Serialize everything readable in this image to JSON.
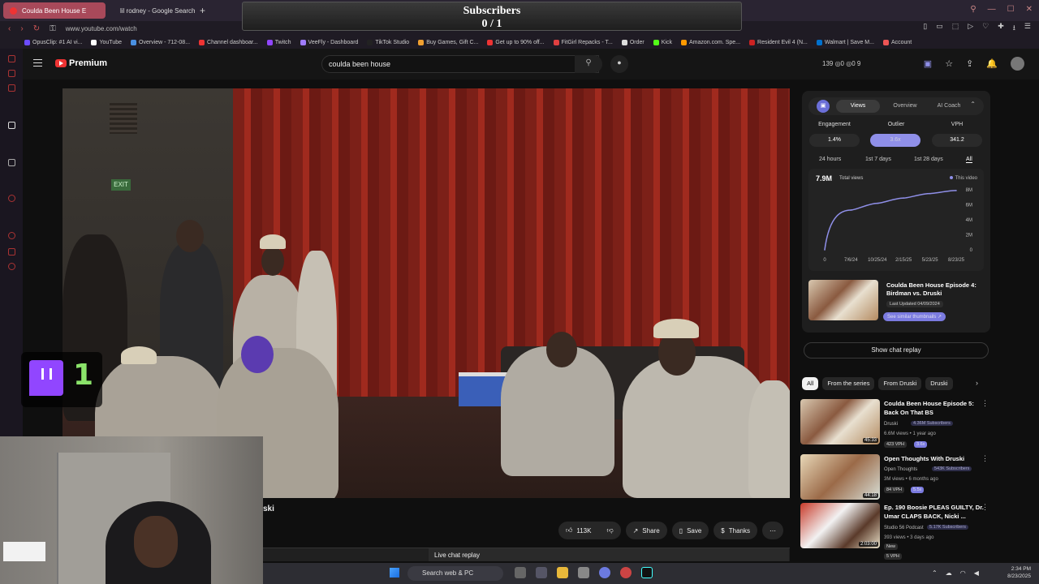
{
  "browser": {
    "tabs": [
      {
        "label": "Coulda Been House E",
        "active": true
      },
      {
        "label": "lil rodney - Google Search",
        "active": false
      }
    ],
    "new_tab": "+",
    "url": "www.youtube.com/watch",
    "bookmarks": [
      {
        "label": "OpusClip: #1 AI vi...",
        "color": "#6c4cff"
      },
      {
        "label": "YouTube",
        "color": "#ffffff"
      },
      {
        "label": "Overview - 712-08...",
        "color": "#4a90e2"
      },
      {
        "label": "Channel dashboar...",
        "color": "#e33"
      },
      {
        "label": "Twitch",
        "color": "#9146ff"
      },
      {
        "label": "VeeFly - Dashboard",
        "color": "#a07cff"
      },
      {
        "label": "TikTok Studio",
        "color": "#222222"
      },
      {
        "label": "Buy Games, Gift C...",
        "color": "#f0a030"
      },
      {
        "label": "Get up to 90% off...",
        "color": "#e33"
      },
      {
        "label": "FitGirl Repacks - T...",
        "color": "#e04040"
      },
      {
        "label": "Order",
        "color": "#dddddd"
      },
      {
        "label": "Kick",
        "color": "#53fc18"
      },
      {
        "label": "Amazon.com. Spe...",
        "color": "#ff9900"
      },
      {
        "label": "Resident Evil 4 (N...",
        "color": "#cc2222"
      },
      {
        "label": "Walmart | Save M...",
        "color": "#0071ce"
      },
      {
        "label": "Account",
        "color": "#e55"
      }
    ]
  },
  "overlay": {
    "title": "Subscribers",
    "count": "0 / 1"
  },
  "youtube": {
    "logo_label": "Premium",
    "search_value": "coulda been house",
    "header_stats": "139 ◎0 ◎0 9"
  },
  "video": {
    "exit_sign": "EXIT",
    "title_fragment": "ski",
    "like_count": "113K",
    "share_label": "Share",
    "save_label": "Save",
    "thanks_label": "Thanks",
    "live_chat_label": "Live chat replay"
  },
  "twitch": {
    "viewer_count": "1"
  },
  "panel": {
    "tabs": [
      "Views",
      "Overview",
      "AI Coach"
    ],
    "active_tab": "Views",
    "metrics": [
      {
        "label": "Engagement",
        "value": "1.4%"
      },
      {
        "label": "Outlier",
        "value": "3.6x"
      },
      {
        "label": "VPH",
        "value": "341.2"
      }
    ],
    "ranges": [
      "24 hours",
      "1st 7 days",
      "1st 28 days",
      "All"
    ],
    "active_range": "All",
    "total_views_value": "7.9M",
    "total_views_label": "Total views",
    "legend": "This video",
    "featured": {
      "title": "Coulda Been House Episode 4: Birdman vs. Druski",
      "updated": "Last Updated 04/09/2024",
      "similar_button": "See similar thumbnails ↗"
    }
  },
  "chart_data": {
    "type": "line",
    "title": "",
    "x": [
      "0",
      "7/6/24",
      "10/25/24",
      "2/15/25",
      "5/23/25",
      "8/23/25"
    ],
    "series": [
      {
        "name": "This video",
        "values": [
          0,
          5.3,
          6.2,
          6.9,
          7.5,
          7.9
        ]
      }
    ],
    "yticks": [
      "8M",
      "6M",
      "4M",
      "2M",
      "0"
    ],
    "ylim": [
      0,
      8
    ],
    "legend": "top-right",
    "grid": false
  },
  "sidebar": {
    "show_chat": "Show chat replay",
    "chips": [
      "All",
      "From the series",
      "From Druski",
      "Druski"
    ],
    "active_chip": "All",
    "recommendations": [
      {
        "title": "Coulda Been House Episode 5: Back On That BS",
        "channel": "Druski",
        "subs": "4.36M Subscribers",
        "meta": "6.6M views • 1 year ago",
        "vph": "423 VPH",
        "ratio": "3.6x",
        "duration": "45:33"
      },
      {
        "title": "Open Thoughts With Druski",
        "channel": "Open Thoughts",
        "subs": "543K Subscribers",
        "meta": "3M views • 6 months ago",
        "vph": "84 VPH",
        "ratio": "5.5x",
        "duration": "44:18"
      },
      {
        "title": "Ep. 190 Boosie PLEAS GUILTY, Dr. Umar CLAPS BACK, Nicki ...",
        "channel": "Studio 56 Podcast",
        "subs": "5.17K Subscribers",
        "meta": "393 views • 3 days ago",
        "badge": "New",
        "vph": "5 VPH",
        "duration": "2:03:00"
      }
    ]
  },
  "taskbar": {
    "search_placeholder": "Search web & PC",
    "time": "2:34 PM",
    "date": "8/23/2025"
  }
}
